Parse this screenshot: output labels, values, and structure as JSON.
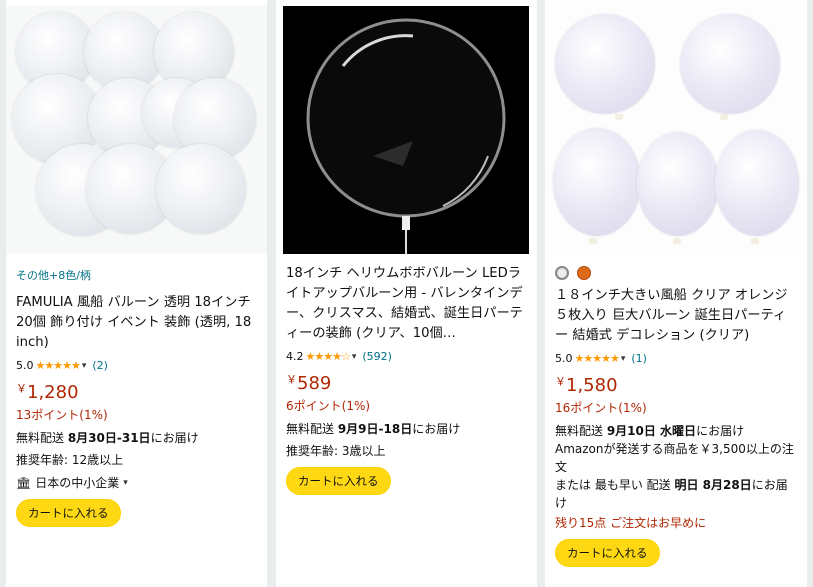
{
  "products": [
    {
      "variants_link": "その他+8色/柄",
      "title": "FAMULIA 風船 バルーン 透明 18インチ 20個 飾り付け イベント 装飾 (透明, 18 inch)",
      "rating": "5.0",
      "stars": "★★★★★",
      "reviews": "(2)",
      "currency": "￥",
      "price": "1,280",
      "points": "13ポイント(1%)",
      "ship_prefix": "無料配送 ",
      "ship_date": "8月30日-31日",
      "ship_suffix": "にお届け",
      "age": "推奨年齢: 12歳以上",
      "seller": "日本の中小企業",
      "cart": "カートに入れる"
    },
    {
      "title": "18インチ ヘリウムボボバルーン LEDライトアップバルーン用 - バレンタインデー、クリスマス、結婚式、誕生日パーティーの装飾 (クリア、10個…",
      "rating": "4.2",
      "stars": "★★★★☆",
      "reviews": "(592)",
      "currency": "￥",
      "price": "589",
      "points": "6ポイント(1%)",
      "ship_prefix": "無料配送 ",
      "ship_date": "9月9日-18日",
      "ship_suffix": "にお届け",
      "age": "推奨年齢: 3歳以上",
      "cart": "カートに入れる"
    },
    {
      "title": "１８インチ大きい風船 クリア オレンジ ５枚入り 巨大バルーン 誕生日パーティー 結婚式 デコレション (クリア)",
      "rating": "5.0",
      "stars": "★★★★★",
      "reviews": "(1)",
      "currency": "￥",
      "price": "1,580",
      "points": "16ポイント(1%)",
      "ship_prefix": "無料配送 ",
      "ship_date": "9月10日 水曜日",
      "ship_suffix": "にお届け",
      "amazon_line": "Amazonが発送する商品を￥3,500以上の注文",
      "alt_prefix": "または 最も早い 配送 ",
      "alt_date": "明日 8月28日",
      "alt_suffix": "にお届け",
      "stock": "残り15点 ご注文はお早めに",
      "cart": "カートに入れる"
    }
  ],
  "colors": {
    "price": "#b12704",
    "link": "#007185",
    "star": "#ff9900",
    "button": "#ffd814"
  }
}
